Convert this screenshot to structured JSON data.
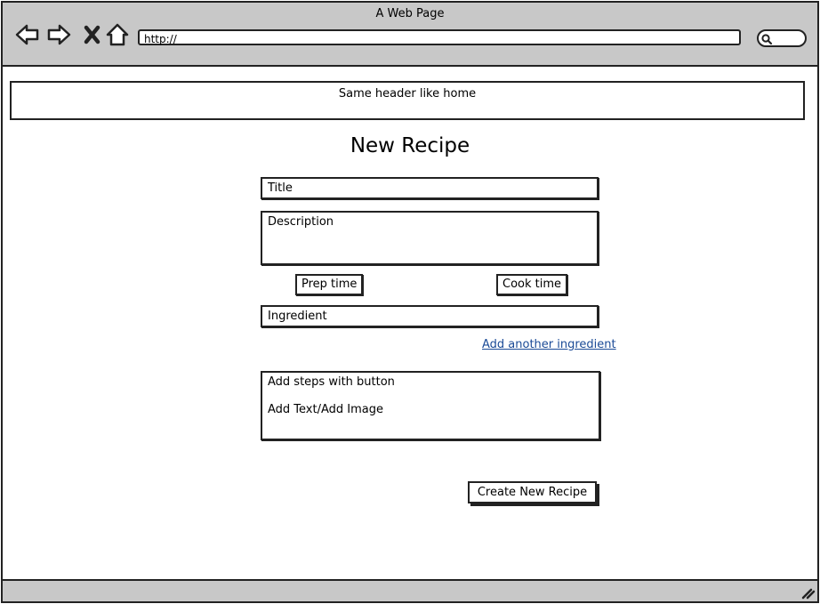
{
  "browser": {
    "window_title": "A Web Page",
    "url": "http://"
  },
  "header": {
    "text": "Same header like home"
  },
  "form": {
    "page_title": "New Recipe",
    "title_label": "Title",
    "description_label": "Description",
    "prep_time_label": "Prep time",
    "cook_time_label": "Cook time",
    "ingredient_label": "Ingredient",
    "add_ingredient_link": "Add another ingredient",
    "steps_line1": "Add steps with button",
    "steps_line2": "Add Text/Add Image",
    "submit_label": "Create New Recipe"
  },
  "colors": {
    "chrome_gray": "#c8c8c8",
    "link_blue": "#1a4a96"
  },
  "icons": [
    "back-arrow-icon",
    "forward-arrow-icon",
    "close-icon",
    "home-icon",
    "search-icon",
    "resize-grip-icon"
  ]
}
